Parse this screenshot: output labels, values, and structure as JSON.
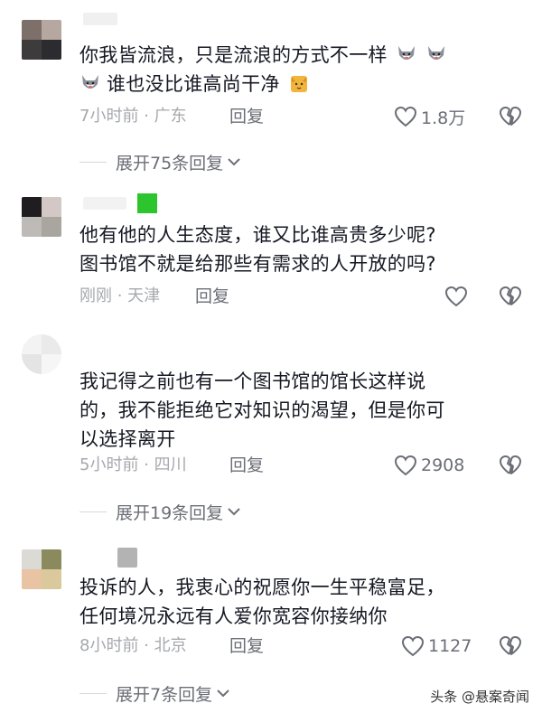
{
  "comments": [
    {
      "text_line1": "你我皆流浪，只是流浪的方式不一样",
      "text_line2": "谁也没比谁高尚干净",
      "meta": "7小时前 · 广东",
      "reply_label": "回复",
      "like_count": "1.8万",
      "expand_label": "展开75条回复",
      "emoji_icons": [
        "husky-emoji-icon",
        "husky-emoji-icon",
        "husky-emoji-icon",
        "cat-emoji-icon"
      ]
    },
    {
      "text_line1": "他有他的人生态度，谁又比谁高贵多少呢?",
      "text_line2": "图书馆不就是给那些有需求的人开放的吗?",
      "meta": "刚刚 · 天津",
      "reply_label": "回复",
      "like_count": ""
    },
    {
      "text_line1": "我记得之前也有一个图书馆的馆长这样说",
      "text_line2": "的，我不能拒绝它对知识的渴望，但是你可",
      "text_line3": "以选择离开",
      "meta": "5小时前 · 四川",
      "reply_label": "回复",
      "like_count": "2908",
      "expand_label": "展开19条回复"
    },
    {
      "text_line1": "投诉的人，我衷心的祝愿你一生平稳富足，",
      "text_line2": "任何境况永远有人爱你宽容你接纳你",
      "meta": "8小时前 · 北京",
      "reply_label": "回复",
      "like_count": "1127",
      "expand_label": "展开7条回复"
    }
  ],
  "watermark": "头条 @悬案奇闻",
  "colors": {
    "text": "#161823",
    "meta": "#a6a8ad",
    "action": "#6b6e76",
    "green_badge": "#2dc52d"
  }
}
